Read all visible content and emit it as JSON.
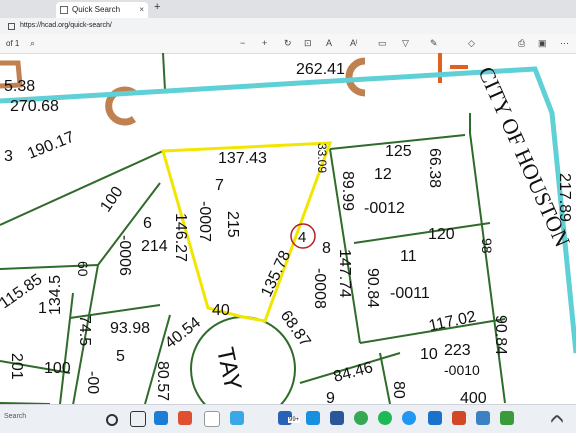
{
  "browser": {
    "tab_title": "Quick Search",
    "new_tab_glyph": "+",
    "tab_close_glyph": "×",
    "url": "https://hcad.org/quick-search/"
  },
  "pdf_toolbar": {
    "page_indicator": "of 1",
    "icons": [
      "search-icon",
      "zoom-out-icon",
      "zoom-in-icon",
      "rotate-icon",
      "fit-page-icon",
      "read-aloud-icon",
      "text-icon",
      "draw-icon",
      "highlight-icon",
      "erase-icon",
      "print-icon",
      "save-icon",
      "more-icon"
    ]
  },
  "map": {
    "road_name": "TAY",
    "city_label": "CITY OF HOUSTON",
    "circled_number": "4",
    "colors": {
      "lot_lines": "#2f6b2a",
      "highlight": "#f2e600",
      "city_limit": "#5fd0d6",
      "symbol": "#c08050",
      "marker": "#b22222"
    },
    "labels": {
      "a262_41": "262.41",
      "a270_68": "270.68",
      "a5_38": "5.38",
      "a190_17": "190.17",
      "a3": "3",
      "a137_43": "137.43",
      "a7": "7",
      "a33_09": "33.09",
      "a125": "125",
      "a66_38": "66.38",
      "a12": "12",
      "a89_99": "89.99",
      "a_0012": "-0012",
      "a100a": "100",
      "a6": "6",
      "a146_27": "146.27",
      "a_0007": "-0007",
      "a215": "215",
      "a214": "214",
      "a_0006": "-0006",
      "a120": "120",
      "a11": "11",
      "a98": "98",
      "a135_78": "135.78",
      "a8": "8",
      "a_0008": "-0008",
      "a147_74": "147.74",
      "a90_84a": "90.84",
      "a_0011": "-0011",
      "a115_85": "115.85",
      "a134_5": "134.5",
      "a60": "60",
      "a1": "1",
      "a201": "201",
      "a93_98": "93.98",
      "a40": "40",
      "a40_54": "40.54",
      "a68_87": "68.87",
      "a117_02": "117.02",
      "a90_84b": "90.84",
      "a74_5": "74.5",
      "a100b": "100",
      "a5": "5",
      "a80_57": "80.57",
      "a84_46": "84.46",
      "a10": "10",
      "a223": "223",
      "a_0010": "-0010",
      "a9": "9",
      "a80": "80",
      "a_00": "-00",
      "a400": "400",
      "a217_89": "217.89"
    }
  },
  "taskbar": {
    "search_caption": "Search",
    "badge": "99+"
  }
}
